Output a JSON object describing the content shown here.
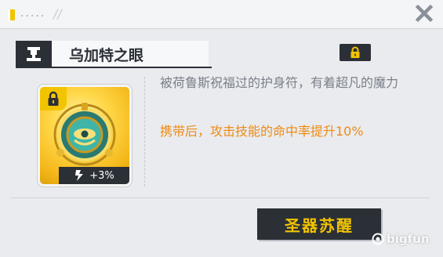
{
  "titlebar": {
    "dots": ".....",
    "slash": "//"
  },
  "relic": {
    "name": "乌加特之眼",
    "description": "被荷鲁斯祝福过的护身符，有着超凡的魔力",
    "effect": "携带后，攻击技能的命中率提升10%",
    "bonus": "+3%"
  },
  "actions": {
    "awaken_label": "圣器苏醒"
  },
  "watermark": {
    "text": "bigfun"
  },
  "colors": {
    "accent_yellow": "#f2c400",
    "effect_orange": "#f08a12",
    "dark": "#2b2f36"
  },
  "icons": {
    "close": "close-icon",
    "relic_type": "relic-type-icon",
    "lock": "lock-icon",
    "bonus": "bonus-icon"
  }
}
